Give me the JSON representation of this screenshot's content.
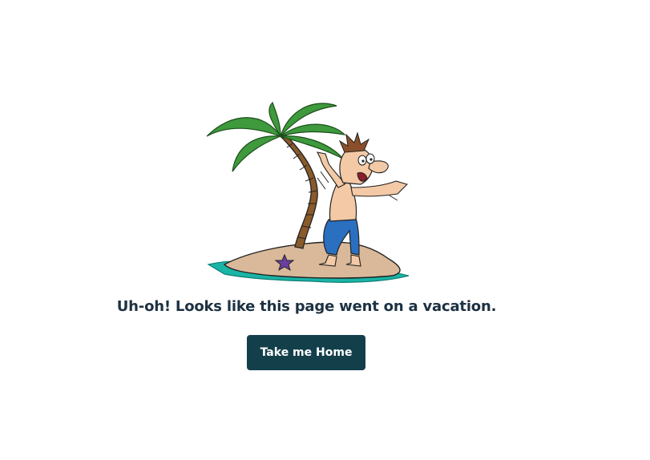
{
  "illustration": {
    "name": "castaway-island-illustration",
    "colors": {
      "water": "#19b5a6",
      "sand": "#d9b99a",
      "palm_leaves": "#3e9a3c",
      "trunk": "#8a5a2b",
      "star": "#6a3fa0",
      "pants": "#2a6fc0",
      "skin": "#f3c9a6"
    }
  },
  "main": {
    "message": "Uh-oh! Looks like this page went on a vacation.",
    "home_button_label": "Take me Home"
  },
  "colors": {
    "text": "#1d3142",
    "button_bg": "#133f4b",
    "button_text": "#ffffff"
  }
}
